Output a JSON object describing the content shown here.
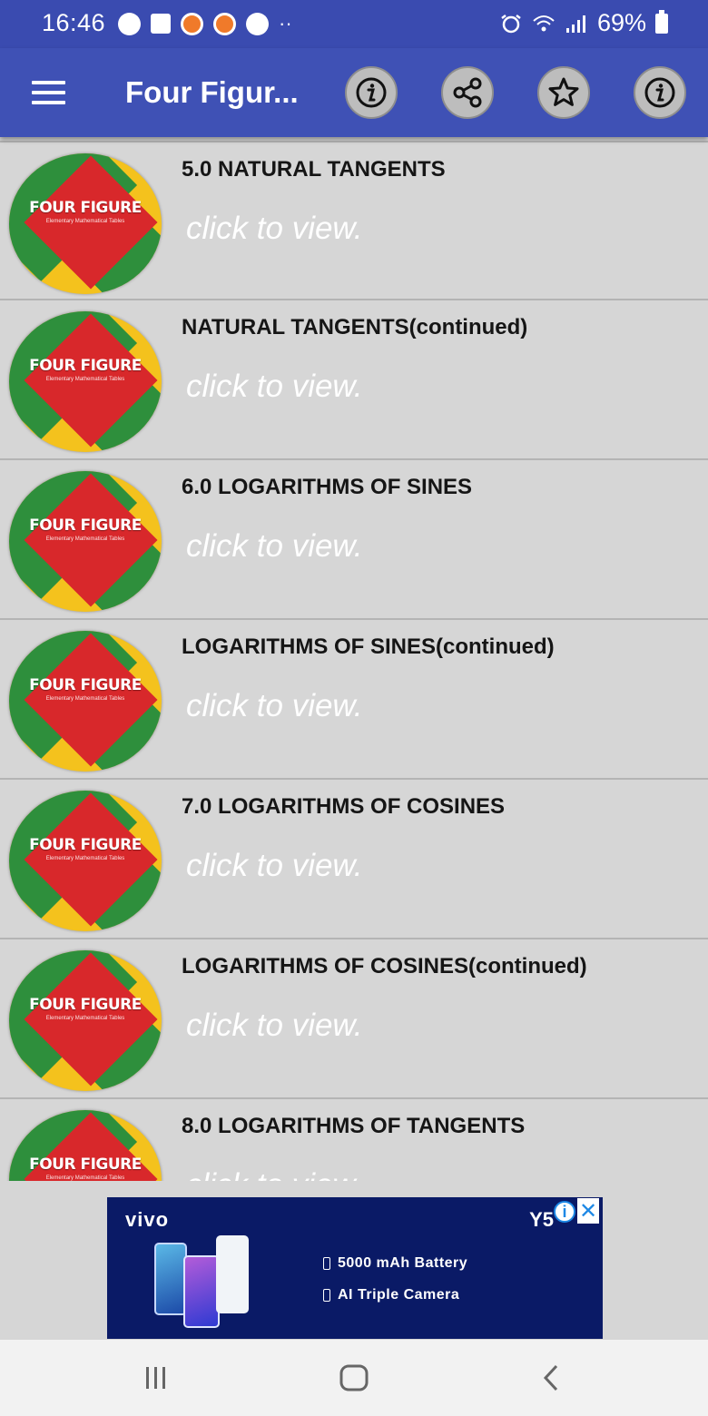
{
  "status_bar": {
    "time": "16:46",
    "notification_icons": [
      "music-icon",
      "facebook-icon",
      "firefox-icon",
      "firefox-icon",
      "clock-app-icon"
    ],
    "more": "··",
    "battery_percent": "69%"
  },
  "app_bar": {
    "title": "Four Figur...",
    "actions": [
      "info-icon",
      "share-icon",
      "star-icon",
      "info-icon"
    ]
  },
  "thumbnail": {
    "text": "FOUR FIGURE",
    "sub": "Elementary Mathematical Tables"
  },
  "items": [
    {
      "title": "5.0 NATURAL TANGENTS",
      "subtitle": "click to view."
    },
    {
      "title": "NATURAL TANGENTS(continued)",
      "subtitle": "click to view."
    },
    {
      "title": "6.0 LOGARITHMS OF SINES",
      "subtitle": "click to view."
    },
    {
      "title": "LOGARITHMS OF SINES(continued)",
      "subtitle": "click to view."
    },
    {
      "title": "7.0 LOGARITHMS OF COSINES",
      "subtitle": "click to view."
    },
    {
      "title": "LOGARITHMS OF COSINES(continued)",
      "subtitle": "click to view."
    },
    {
      "title": "8.0 LOGARITHMS OF TANGENTS",
      "subtitle": "click to view."
    }
  ],
  "ad": {
    "brand": "vivo",
    "brand2": "Y5",
    "info": "i",
    "close": "✕",
    "feature1": "5000 mAh Battery",
    "feature2": "AI Triple Camera"
  },
  "colors": {
    "status_bar": "#3a4bb0",
    "app_bar": "#3f51b5",
    "list_bg": "#d6d6d6",
    "ad_bg": "#0a1a66"
  }
}
